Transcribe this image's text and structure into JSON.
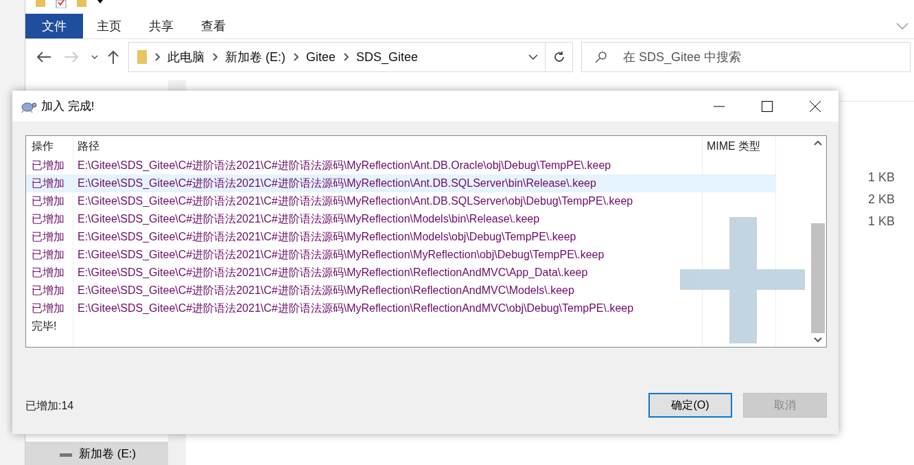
{
  "explorer": {
    "ribbon_tabs": [
      {
        "label": "文件",
        "selected": true
      },
      {
        "label": "主页",
        "selected": false
      },
      {
        "label": "共享",
        "selected": false
      },
      {
        "label": "查看",
        "selected": false
      }
    ],
    "breadcrumb": [
      "此电脑",
      "新加卷 (E:)",
      "Gitee",
      "SDS_Gitee"
    ],
    "search": {
      "placeholder": "在 SDS_Gitee 中搜索"
    },
    "nav_items": [
      {
        "label": "新加卷 (E:)",
        "selected": true
      }
    ],
    "sizes": [
      "1 KB",
      "2 KB",
      "1 KB"
    ]
  },
  "dialog": {
    "title": "加入 完成!",
    "columns": [
      "操作",
      "路径",
      "MIME 类型"
    ],
    "rows": [
      {
        "kind": "added",
        "action": "已增加",
        "path": "E:\\Gitee\\SDS_Gitee\\C#进阶语法2021\\C#进阶语法源码\\MyReflection\\Ant.DB.Oracle\\obj\\Debug\\TempPE\\.keep",
        "selected": false
      },
      {
        "kind": "added",
        "action": "已增加",
        "path": "E:\\Gitee\\SDS_Gitee\\C#进阶语法2021\\C#进阶语法源码\\MyReflection\\Ant.DB.SQLServer\\bin\\Release\\.keep",
        "selected": true
      },
      {
        "kind": "added",
        "action": "已增加",
        "path": "E:\\Gitee\\SDS_Gitee\\C#进阶语法2021\\C#进阶语法源码\\MyReflection\\Ant.DB.SQLServer\\obj\\Debug\\TempPE\\.keep",
        "selected": false
      },
      {
        "kind": "added",
        "action": "已增加",
        "path": "E:\\Gitee\\SDS_Gitee\\C#进阶语法2021\\C#进阶语法源码\\MyReflection\\Models\\bin\\Release\\.keep",
        "selected": false
      },
      {
        "kind": "added",
        "action": "已增加",
        "path": "E:\\Gitee\\SDS_Gitee\\C#进阶语法2021\\C#进阶语法源码\\MyReflection\\Models\\obj\\Debug\\TempPE\\.keep",
        "selected": false
      },
      {
        "kind": "added",
        "action": "已增加",
        "path": "E:\\Gitee\\SDS_Gitee\\C#进阶语法2021\\C#进阶语法源码\\MyReflection\\MyReflection\\obj\\Debug\\TempPE\\.keep",
        "selected": false
      },
      {
        "kind": "added",
        "action": "已增加",
        "path": "E:\\Gitee\\SDS_Gitee\\C#进阶语法2021\\C#进阶语法源码\\MyReflection\\ReflectionAndMVC\\App_Data\\.keep",
        "selected": false
      },
      {
        "kind": "added",
        "action": "已增加",
        "path": "E:\\Gitee\\SDS_Gitee\\C#进阶语法2021\\C#进阶语法源码\\MyReflection\\ReflectionAndMVC\\Models\\.keep",
        "selected": false
      },
      {
        "kind": "added",
        "action": "已增加",
        "path": "E:\\Gitee\\SDS_Gitee\\C#进阶语法2021\\C#进阶语法源码\\MyReflection\\ReflectionAndMVC\\obj\\Debug\\TempPE\\.keep",
        "selected": false
      },
      {
        "kind": "done",
        "action": "完毕!",
        "selected": false
      }
    ],
    "summary": "已增加:14",
    "buttons": [
      {
        "label": "确定(O)",
        "default": true,
        "disabled": false
      },
      {
        "label": "取消",
        "default": false,
        "disabled": true
      }
    ]
  }
}
